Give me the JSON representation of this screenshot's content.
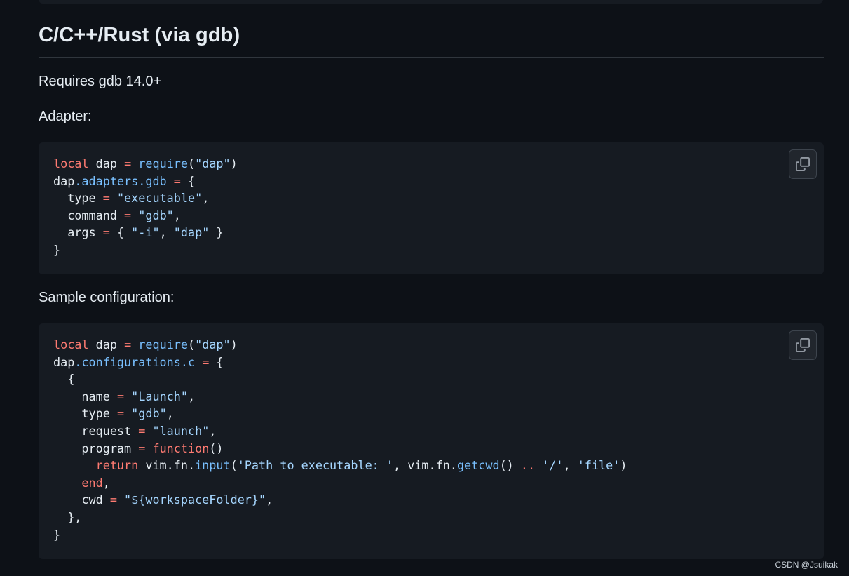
{
  "section": {
    "heading": "C/C++/Rust (via gdb)",
    "requirement": "Requires gdb 14.0+",
    "adapter_label": "Adapter:",
    "sample_label": "Sample configuration:"
  },
  "adapter_code": [
    [
      {
        "t": "local",
        "c": "kw"
      },
      {
        "t": " dap "
      },
      {
        "t": "=",
        "c": "kw"
      },
      {
        "t": " "
      },
      {
        "t": "require",
        "c": "prop"
      },
      {
        "t": "("
      },
      {
        "t": "\"dap\"",
        "c": "str"
      },
      {
        "t": ")"
      }
    ],
    [
      {
        "t": "dap"
      },
      {
        "t": ".adapters.gdb",
        "c": "prop"
      },
      {
        "t": " "
      },
      {
        "t": "=",
        "c": "kw"
      },
      {
        "t": " {"
      }
    ],
    [
      {
        "t": "  type "
      },
      {
        "t": "=",
        "c": "kw"
      },
      {
        "t": " "
      },
      {
        "t": "\"executable\"",
        "c": "str"
      },
      {
        "t": ","
      }
    ],
    [
      {
        "t": "  command "
      },
      {
        "t": "=",
        "c": "kw"
      },
      {
        "t": " "
      },
      {
        "t": "\"gdb\"",
        "c": "str"
      },
      {
        "t": ","
      }
    ],
    [
      {
        "t": "  args "
      },
      {
        "t": "=",
        "c": "kw"
      },
      {
        "t": " { "
      },
      {
        "t": "\"-i\"",
        "c": "str"
      },
      {
        "t": ", "
      },
      {
        "t": "\"dap\"",
        "c": "str"
      },
      {
        "t": " }"
      }
    ],
    [
      {
        "t": "}"
      }
    ]
  ],
  "sample_code": [
    [
      {
        "t": "local",
        "c": "kw"
      },
      {
        "t": " dap "
      },
      {
        "t": "=",
        "c": "kw"
      },
      {
        "t": " "
      },
      {
        "t": "require",
        "c": "prop"
      },
      {
        "t": "("
      },
      {
        "t": "\"dap\"",
        "c": "str"
      },
      {
        "t": ")"
      }
    ],
    [
      {
        "t": "dap"
      },
      {
        "t": ".configurations.c",
        "c": "prop"
      },
      {
        "t": " "
      },
      {
        "t": "=",
        "c": "kw"
      },
      {
        "t": " {"
      }
    ],
    [
      {
        "t": "  {"
      }
    ],
    [
      {
        "t": "    name "
      },
      {
        "t": "=",
        "c": "kw"
      },
      {
        "t": " "
      },
      {
        "t": "\"Launch\"",
        "c": "str"
      },
      {
        "t": ","
      }
    ],
    [
      {
        "t": "    type "
      },
      {
        "t": "=",
        "c": "kw"
      },
      {
        "t": " "
      },
      {
        "t": "\"gdb\"",
        "c": "str"
      },
      {
        "t": ","
      }
    ],
    [
      {
        "t": "    request "
      },
      {
        "t": "=",
        "c": "kw"
      },
      {
        "t": " "
      },
      {
        "t": "\"launch\"",
        "c": "str"
      },
      {
        "t": ","
      }
    ],
    [
      {
        "t": "    program "
      },
      {
        "t": "=",
        "c": "kw"
      },
      {
        "t": " "
      },
      {
        "t": "function",
        "c": "kw"
      },
      {
        "t": "()"
      }
    ],
    [
      {
        "t": "      "
      },
      {
        "t": "return",
        "c": "kw"
      },
      {
        "t": " vim.fn."
      },
      {
        "t": "input",
        "c": "prop"
      },
      {
        "t": "("
      },
      {
        "t": "'Path to executable: '",
        "c": "str"
      },
      {
        "t": ", vim.fn."
      },
      {
        "t": "getcwd",
        "c": "prop"
      },
      {
        "t": "() "
      },
      {
        "t": "..",
        "c": "kw"
      },
      {
        "t": " "
      },
      {
        "t": "'/'",
        "c": "str"
      },
      {
        "t": ", "
      },
      {
        "t": "'file'",
        "c": "str"
      },
      {
        "t": ")"
      }
    ],
    [
      {
        "t": "    "
      },
      {
        "t": "end",
        "c": "kw"
      },
      {
        "t": ","
      }
    ],
    [
      {
        "t": "    cwd "
      },
      {
        "t": "=",
        "c": "kw"
      },
      {
        "t": " "
      },
      {
        "t": "\"${workspaceFolder}\"",
        "c": "str"
      },
      {
        "t": ","
      }
    ],
    [
      {
        "t": "  },"
      }
    ],
    [
      {
        "t": "}"
      }
    ]
  ],
  "copy_icon": "copy-icon",
  "watermark": "CSDN @Jsuikak",
  "colors": {
    "background": "#0d1117",
    "code_background": "#161b22",
    "keyword": "#ff7b72",
    "string": "#a5d6ff",
    "property": "#79c0ff",
    "text": "#e6edf3"
  }
}
